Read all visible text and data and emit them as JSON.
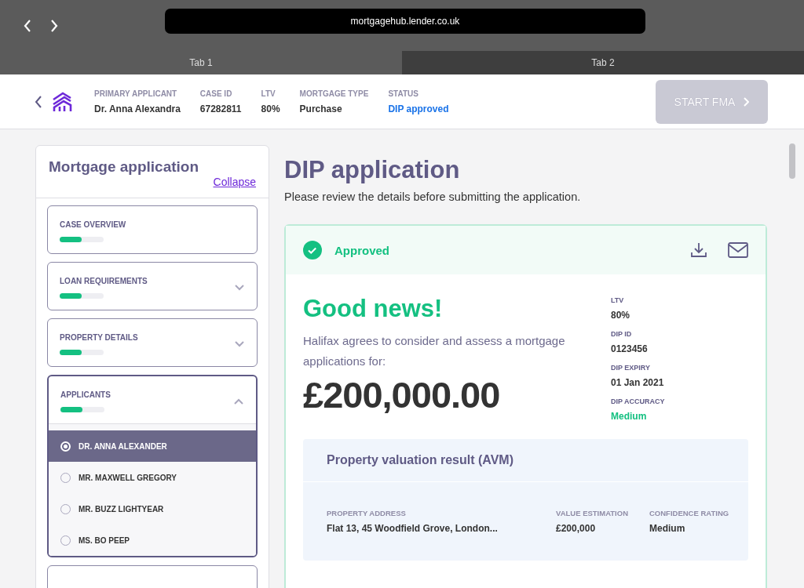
{
  "browser": {
    "url": "mortgagehub.lender.co.uk",
    "tabs": [
      {
        "label": "Tab 1",
        "selected": true
      },
      {
        "label": "Tab 2",
        "selected": false
      }
    ]
  },
  "header": {
    "fields": [
      {
        "label": "PRIMARY APPLICANT",
        "value": "Dr. Anna Alexandra",
        "kind": "plain"
      },
      {
        "label": "CASE ID",
        "value": "67282811",
        "kind": "plain"
      },
      {
        "label": "LTV",
        "value": "80%",
        "kind": "plain"
      },
      {
        "label": "MORTGAGE TYPE",
        "value": "Purchase",
        "kind": "plain"
      },
      {
        "label": "STATUS",
        "value": "DIP approved",
        "kind": "status"
      }
    ],
    "button": {
      "label": "START FMA",
      "disabled": true
    }
  },
  "sidebar": {
    "title": "Mortgage application",
    "collapse": "Collapse",
    "sections": [
      {
        "label": "CASE OVERVIEW",
        "kind": "plain",
        "level": 0.5
      },
      {
        "label": "LOAN REQUIREMENTS",
        "kind": "collapsible",
        "expanded": false,
        "level": 0.5
      },
      {
        "label": "PROPERTY DETAILS",
        "kind": "collapsible",
        "expanded": false,
        "level": 0.5
      },
      {
        "label": "APPLICANTS",
        "kind": "collapsible",
        "expanded": true,
        "level": 0.5,
        "children": [
          {
            "label": "DR. ANNA ALEXANDER",
            "selected": true
          },
          {
            "label": "MR. MAXWELL GREGORY",
            "selected": false
          },
          {
            "label": "MR. BUZZ LIGHTYEAR",
            "selected": false
          },
          {
            "label": "MS. BO PEEP",
            "selected": false
          }
        ]
      }
    ]
  },
  "main": {
    "title": "DIP application",
    "subtitle": "Please review the details before submitting the application.",
    "result": {
      "status": "Approved",
      "headline": "Good news!",
      "text": "Halifax agrees to consider and assess a mortgage applications for:",
      "amount": "£200,000.00",
      "facts": [
        {
          "label": "LTV",
          "value": "80%",
          "kind": "plain"
        },
        {
          "label": "DIP ID",
          "value": "0123456",
          "kind": "plain"
        },
        {
          "label": "DIP EXPIRY",
          "value": "01 Jan 2021",
          "kind": "plain"
        },
        {
          "label": "DIP ACCURACY",
          "value": "Medium",
          "kind": "highlight"
        }
      ],
      "valuation": {
        "title": "Property valuation result (AVM)",
        "columns": [
          {
            "label": "PROPERTY ADDRESS",
            "value": "Flat 13, 45 Woodfield Grove, London..."
          },
          {
            "label": "VALUE ESTIMATION",
            "value": "£200,000"
          },
          {
            "label": "CONFIDENCE RATING",
            "value": "Medium"
          }
        ]
      }
    }
  }
}
